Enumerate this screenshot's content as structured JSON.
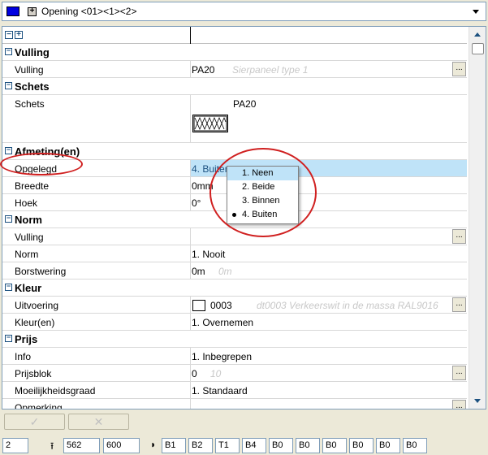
{
  "window": {
    "selector_title": "Opening <01><1><2>"
  },
  "grid": {
    "categories": {
      "vulling": "Vulling",
      "schets": "Schets",
      "afmeting": "Afmeting(en)",
      "norm": "Norm",
      "kleur": "Kleur",
      "prijs": "Prijs"
    },
    "rows": {
      "vulling": {
        "label": "Vulling",
        "value": "PA20",
        "hint": "Sierpaneel type 1"
      },
      "schets": {
        "label": "Schets",
        "value": "PA20"
      },
      "opgelegd": {
        "label": "Opgelegd",
        "value": "4. Buiten"
      },
      "breedte": {
        "label": "Breedte",
        "value": "0mm"
      },
      "hoek": {
        "label": "Hoek",
        "value": "0°"
      },
      "norm_vulling": {
        "label": "Vulling",
        "value": ""
      },
      "norm": {
        "label": "Norm",
        "value": "1. Nooit"
      },
      "borstwering": {
        "label": "Borstwering",
        "value": "0m",
        "hint": "0m"
      },
      "uitvoering": {
        "label": "Uitvoering",
        "value": "0003",
        "hint": "dt0003 Verkeerswit in de massa RAL9016"
      },
      "kleuren": {
        "label": "Kleur(en)",
        "value": "1. Overnemen"
      },
      "info": {
        "label": "Info",
        "value": "1. Inbegrepen"
      },
      "prijsblok": {
        "label": "Prijsblok",
        "value": "0",
        "hint": "10"
      },
      "moeilijkheid": {
        "label": "Moeilijkheidsgraad",
        "value": "1. Standaard"
      },
      "opmerking": {
        "label": "Opmerking",
        "value": ""
      }
    },
    "ellipsis": "..."
  },
  "popup": {
    "items": [
      "1. Neen",
      "2. Beide",
      "3. Binnen",
      "4. Buiten"
    ],
    "hover_index": 0,
    "selected_index": 3
  },
  "buttons": {
    "ok": "✓",
    "cancel": "✕"
  },
  "status": {
    "field1": "2",
    "height": "562",
    "width": "600",
    "codes": [
      "B1",
      "B2",
      "T1",
      "B4",
      "B0",
      "B0",
      "B0",
      "B0",
      "B0",
      "B0"
    ]
  },
  "colors": {
    "selection": "#bfe3f8",
    "annotation_ring": "#d02020",
    "swatch_blue": "#0000e0"
  }
}
